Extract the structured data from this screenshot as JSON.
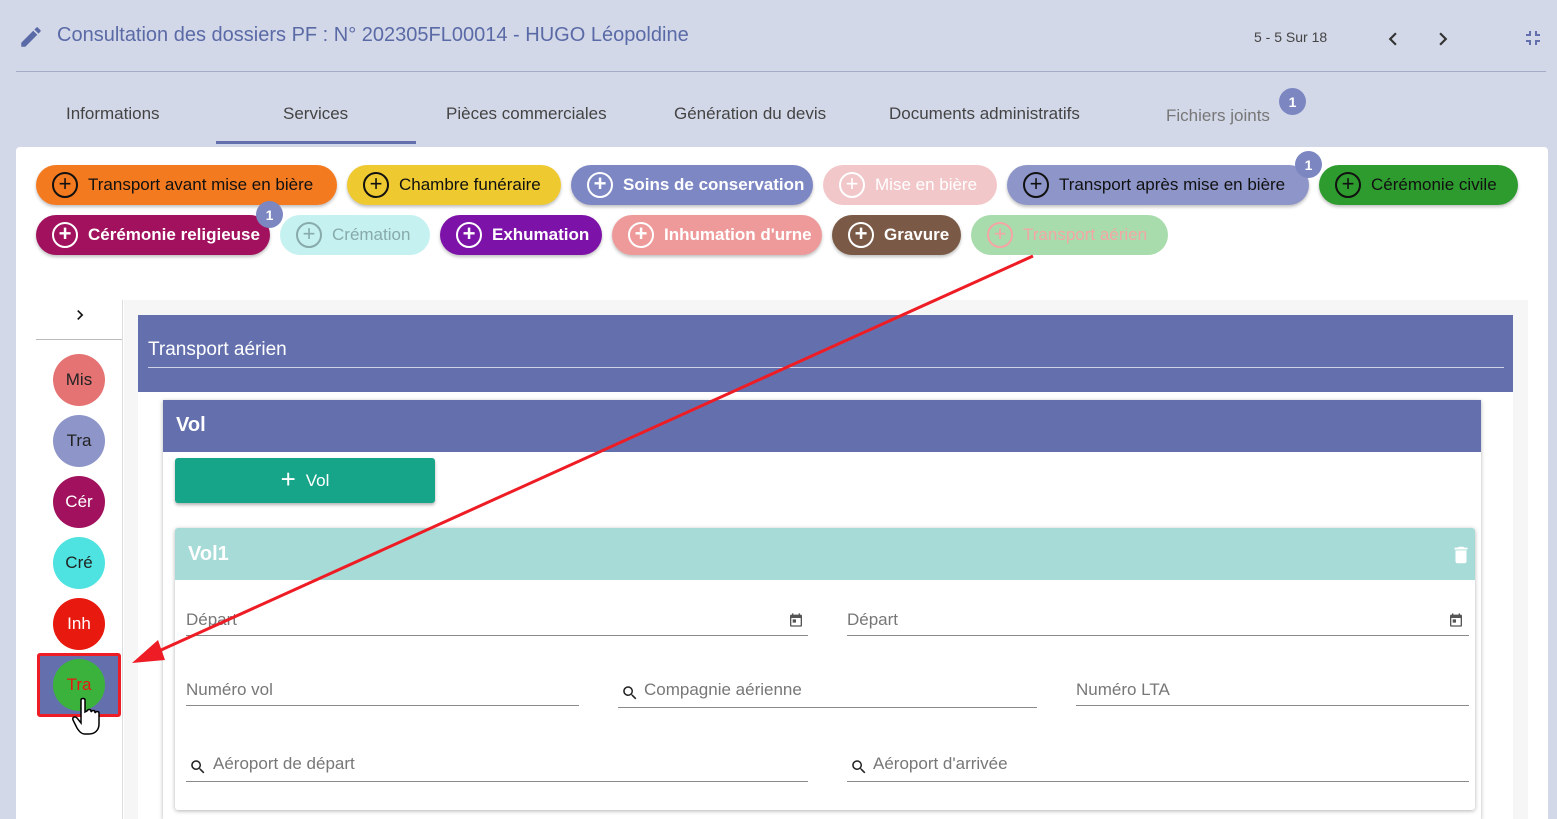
{
  "header": {
    "title": "Consultation des dossiers PF : N° 202305FL00014 - HUGO Léopoldine",
    "pager": "5 - 5 Sur 18"
  },
  "tabs": [
    {
      "label": "Informations"
    },
    {
      "label": "Services"
    },
    {
      "label": "Pièces commerciales"
    },
    {
      "label": "Génération du devis"
    },
    {
      "label": "Documents administratifs"
    },
    {
      "label": "Fichiers joints",
      "badge": "1"
    }
  ],
  "services": [
    {
      "label": "Transport avant mise en bière",
      "color": "#f47a20"
    },
    {
      "label": "Chambre funéraire",
      "color": "#eec92f"
    },
    {
      "label": "Soins de conservation",
      "color": "#7d87c4"
    },
    {
      "label": "Mise en bière",
      "color": "#f2c7c9"
    },
    {
      "label": "Transport après mise en bière",
      "color": "#8e96c9",
      "badge": "1"
    },
    {
      "label": "Cérémonie civile",
      "color": "#2e9b2e"
    },
    {
      "label": "Cérémonie religieuse",
      "color": "#a1115e",
      "badge": "1"
    },
    {
      "label": "Crémation",
      "color": "#c5f1f0"
    },
    {
      "label": "Exhumation",
      "color": "#7d12a8"
    },
    {
      "label": "Inhumation d'urne",
      "color": "#ef9a9a"
    },
    {
      "label": "Gravure",
      "color": "#7a5a47"
    },
    {
      "label": "Transport aérien",
      "color": "#a8dcac"
    }
  ],
  "sidebar": {
    "items": [
      {
        "label": "Mis",
        "color": "#e57373"
      },
      {
        "label": "Tra",
        "color": "#8e96c9"
      },
      {
        "label": "Cér",
        "color": "#a1115e"
      },
      {
        "label": "Cré",
        "color": "#4ee3e0"
      },
      {
        "label": "Inh",
        "color": "#e8190e"
      },
      {
        "label": "Tra",
        "color": "#3bb23b"
      }
    ]
  },
  "section": {
    "title": "Transport aérien",
    "vol_title": "Vol",
    "add_vol_label": "Vol",
    "vol1": {
      "title": "Vol1",
      "fields": {
        "depart1": "Départ",
        "depart2": "Départ",
        "numero_vol": "Numéro vol",
        "compagnie": "Compagnie aérienne",
        "numero_lta": "Numéro LTA",
        "aeroport_depart": "Aéroport de départ",
        "aeroport_arrivee": "Aéroport d'arrivée"
      }
    }
  }
}
